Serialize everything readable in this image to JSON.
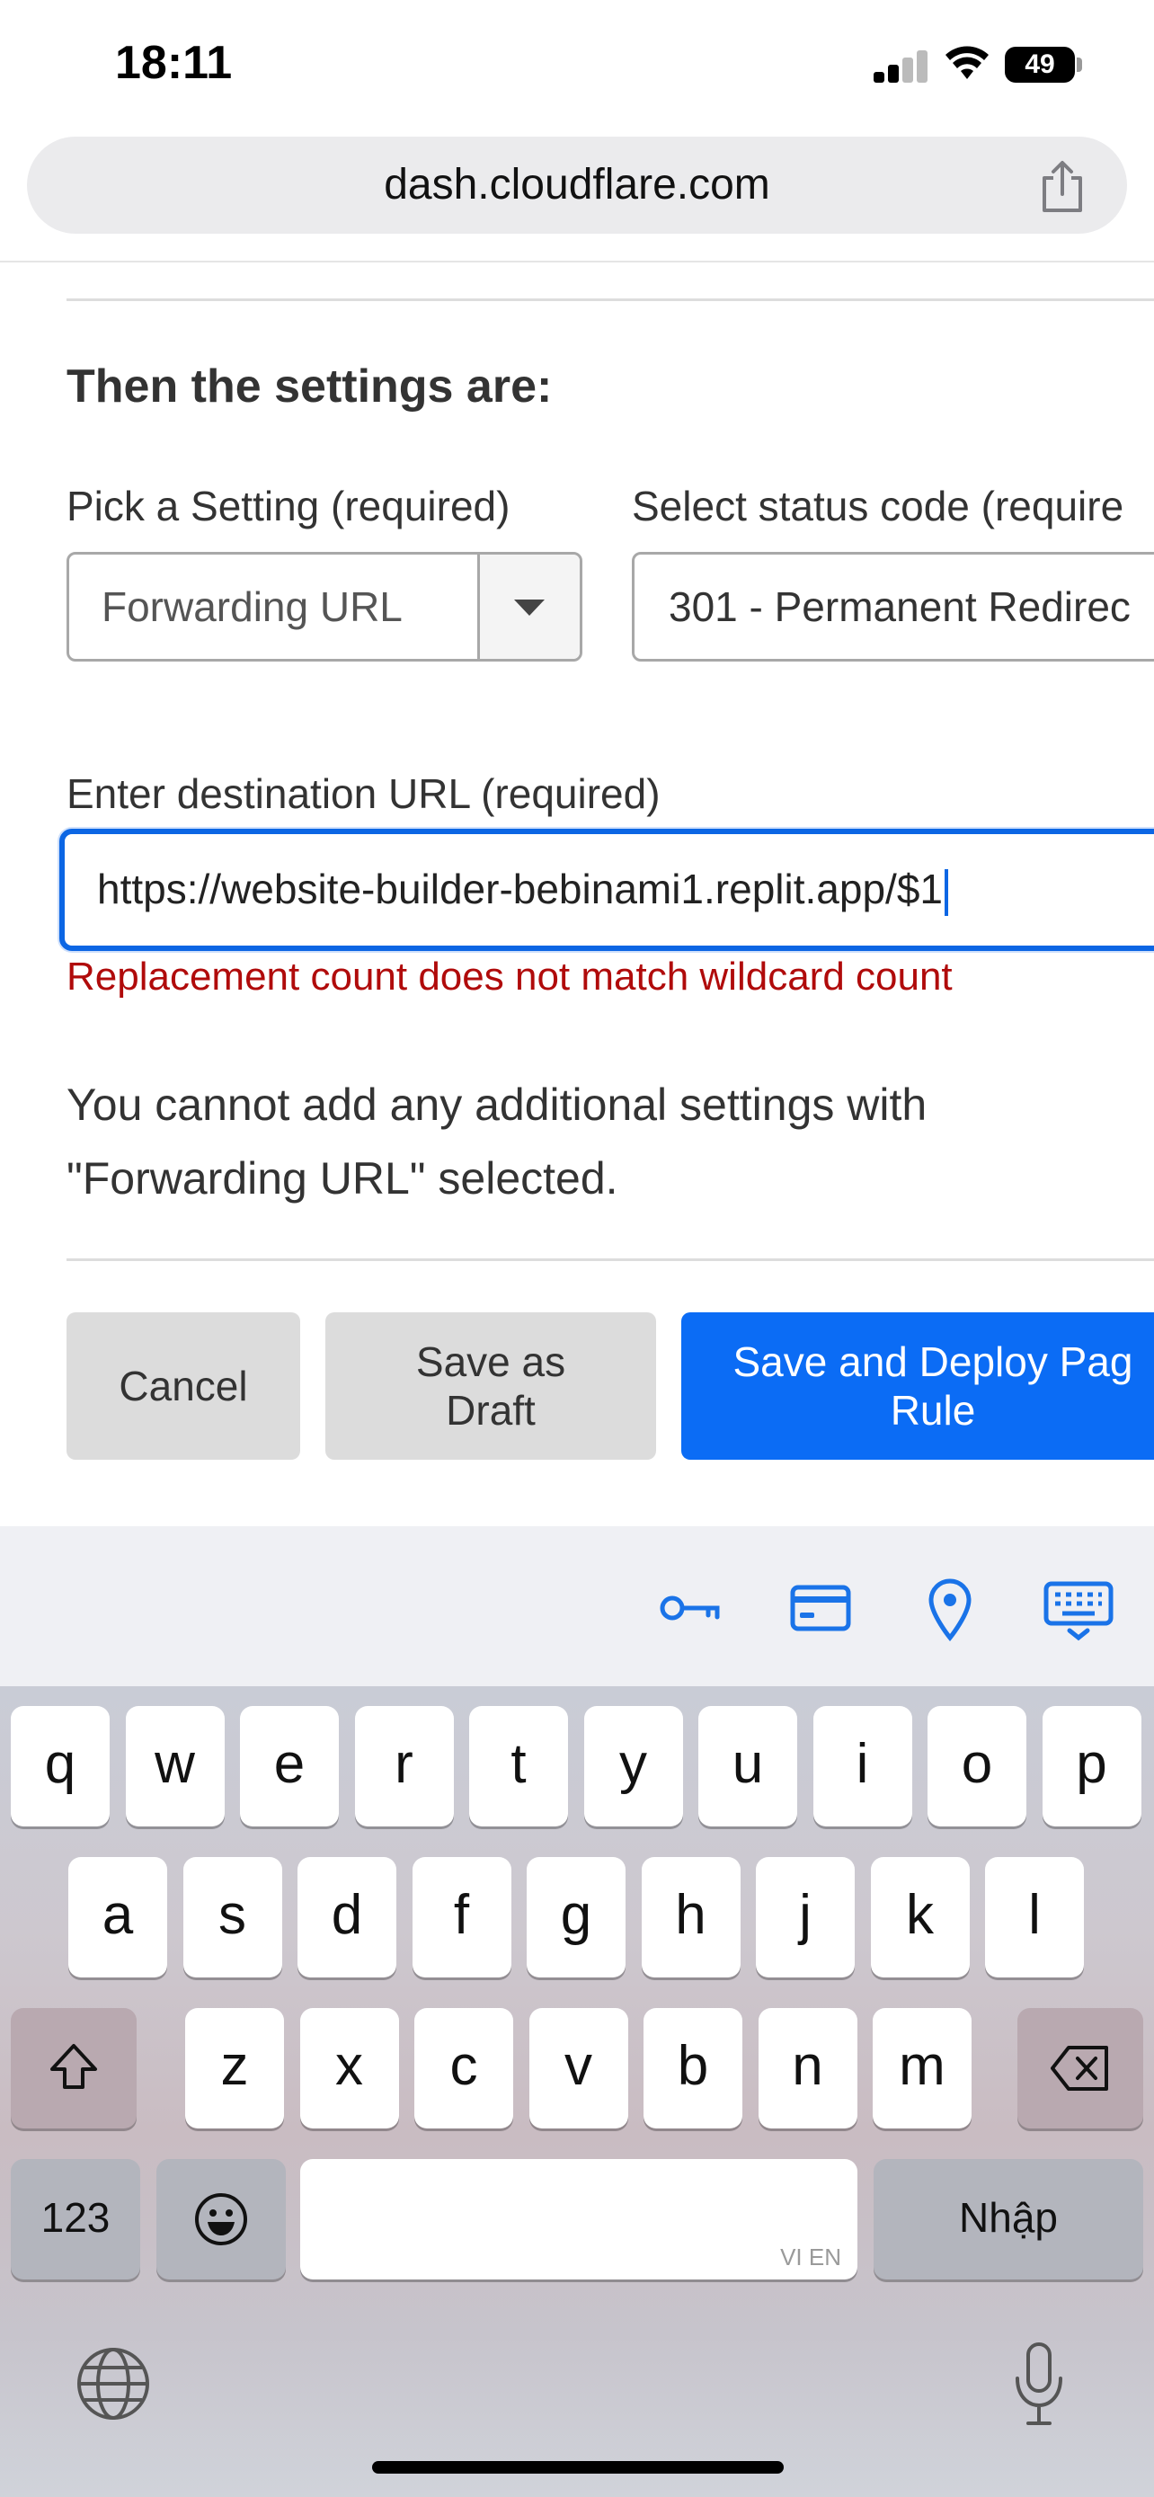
{
  "status_bar": {
    "time": "18:11",
    "battery": "49"
  },
  "browser": {
    "url": "dash.cloudflare.com"
  },
  "form": {
    "heading": "Then the settings are:",
    "setting_label": "Pick a Setting (required)",
    "setting_value": "Forwarding URL",
    "status_label": "Select status code (require",
    "status_value": "301 - Permanent Redirec",
    "destination_label": "Enter destination URL (required)",
    "destination_value": "https://website-builder-bebinami1.replit.app/$1",
    "error": "Replacement count does not match wildcard count",
    "info": "You cannot add any additional settings with \"Forwarding URL\" selected."
  },
  "buttons": {
    "cancel": "Cancel",
    "draft_line1": "Save as",
    "draft_line2": "Draft",
    "deploy_line1": "Save and Deploy Pag",
    "deploy_line2": "Rule"
  },
  "autofill": {
    "icons": [
      "key-icon",
      "credit-card-icon",
      "location-pin-icon",
      "keyboard-icon"
    ]
  },
  "keyboard": {
    "row1": [
      "q",
      "w",
      "e",
      "r",
      "t",
      "y",
      "u",
      "i",
      "o",
      "p"
    ],
    "row2": [
      "a",
      "s",
      "d",
      "f",
      "g",
      "h",
      "j",
      "k",
      "l"
    ],
    "row3": [
      "z",
      "x",
      "c",
      "v",
      "b",
      "n",
      "m"
    ],
    "numbers_key": "123",
    "space_tag": "VI EN",
    "return_key": "Nhập"
  },
  "colors": {
    "accent": "#0c66e4",
    "error": "#b00b0b",
    "deploy_button": "#0b6cf5"
  }
}
